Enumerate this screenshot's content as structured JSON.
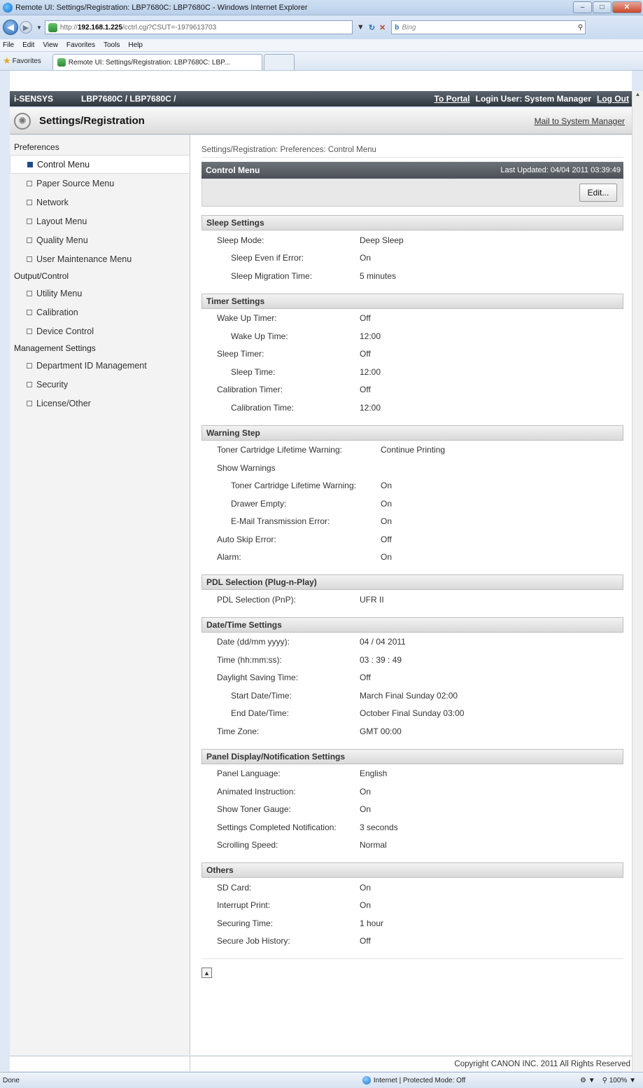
{
  "browser": {
    "window_title": "Remote UI: Settings/Registration: LBP7680C: LBP7680C - Windows Internet Explorer",
    "url_prefix": "http://",
    "url_host": "192.168.1.225",
    "url_path": "/cctrl.cgi?CSUT=-1979613703",
    "search_placeholder": "Bing",
    "menu": [
      "File",
      "Edit",
      "View",
      "Favorites",
      "Tools",
      "Help"
    ],
    "favorites_label": "Favorites",
    "tab_title": "Remote UI: Settings/Registration: LBP7680C: LBP...",
    "status_left": "Done",
    "status_zone": "Internet | Protected Mode: Off",
    "zoom": "100%"
  },
  "header": {
    "brand": "i-SENSYS",
    "model": "LBP7680C / LBP7680C /",
    "to_portal": "To Portal",
    "login_user": "Login User: System Manager",
    "log_out": "Log Out",
    "settings_title": "Settings/Registration",
    "mail_link": "Mail to System Manager"
  },
  "sidebar": {
    "groups": [
      {
        "label": "Preferences",
        "items": [
          "Control Menu",
          "Paper Source Menu",
          "Network",
          "Layout Menu",
          "Quality Menu",
          "User Maintenance Menu"
        ]
      },
      {
        "label": "Output/Control",
        "items": [
          "Utility Menu",
          "Calibration",
          "Device Control"
        ]
      },
      {
        "label": "Management Settings",
        "items": [
          "Department ID Management",
          "Security",
          "License/Other"
        ]
      }
    ]
  },
  "main": {
    "breadcrumb": "Settings/Registration: Preferences: Control Menu",
    "panel_title": "Control Menu",
    "last_updated": "Last Updated: 04/04 2011 03:39:49",
    "edit_label": "Edit...",
    "sections": {
      "sleep": {
        "title": "Sleep Settings",
        "rows": [
          {
            "label": "Sleep Mode:",
            "value": "Deep Sleep"
          },
          {
            "label": "Sleep Even if Error:",
            "value": "On"
          },
          {
            "label": "Sleep Migration Time:",
            "value": "5 minutes"
          }
        ]
      },
      "timer": {
        "title": "Timer Settings",
        "rows": [
          {
            "label": "Wake Up Timer:",
            "value": "Off"
          },
          {
            "label": "Wake Up Time:",
            "value": "12:00"
          },
          {
            "label": "Sleep Timer:",
            "value": "Off"
          },
          {
            "label": "Sleep Time:",
            "value": "12:00"
          },
          {
            "label": "Calibration Timer:",
            "value": "Off"
          },
          {
            "label": "Calibration Time:",
            "value": "12:00"
          }
        ]
      },
      "warning": {
        "title": "Warning Step",
        "rows": [
          {
            "label": "Toner Cartridge Lifetime Warning:",
            "value": "Continue Printing"
          },
          {
            "label": "Show Warnings",
            "value": ""
          },
          {
            "label": "Toner Cartridge Lifetime Warning:",
            "value": "On"
          },
          {
            "label": "Drawer Empty:",
            "value": "On"
          },
          {
            "label": "E-Mail Transmission Error:",
            "value": "On"
          },
          {
            "label": "Auto Skip Error:",
            "value": "Off"
          },
          {
            "label": "Alarm:",
            "value": "On"
          }
        ]
      },
      "pdl": {
        "title": "PDL Selection (Plug-n-Play)",
        "rows": [
          {
            "label": "PDL Selection (PnP):",
            "value": "UFR II"
          }
        ]
      },
      "datetime": {
        "title": "Date/Time Settings",
        "rows": [
          {
            "label": "Date (dd/mm yyyy):",
            "value": "04 / 04 2011"
          },
          {
            "label": "Time (hh:mm:ss):",
            "value": "03 : 39 : 49"
          },
          {
            "label": "Daylight Saving Time:",
            "value": "Off"
          },
          {
            "label": "Start Date/Time:",
            "value": "March Final Sunday 02:00"
          },
          {
            "label": "End Date/Time:",
            "value": "October Final Sunday 03:00"
          },
          {
            "label": "Time Zone:",
            "value": "GMT 00:00"
          }
        ]
      },
      "panel": {
        "title": "Panel Display/Notification Settings",
        "rows": [
          {
            "label": "Panel Language:",
            "value": "English"
          },
          {
            "label": "Animated Instruction:",
            "value": "On"
          },
          {
            "label": "Show Toner Gauge:",
            "value": "On"
          },
          {
            "label": "Settings Completed Notification:",
            "value": "3 seconds"
          },
          {
            "label": "Scrolling Speed:",
            "value": "Normal"
          }
        ]
      },
      "others": {
        "title": "Others",
        "rows": [
          {
            "label": "SD Card:",
            "value": "On"
          },
          {
            "label": "Interrupt Print:",
            "value": "On"
          },
          {
            "label": "Securing Time:",
            "value": "1 hour"
          },
          {
            "label": "Secure Job History:",
            "value": "Off"
          }
        ]
      }
    }
  },
  "footer": {
    "copyright": "Copyright CANON INC. 2011 All Rights Reserved"
  },
  "colors": {
    "header_dark": "#2f363d",
    "active_marker": "#1f4d8c"
  }
}
